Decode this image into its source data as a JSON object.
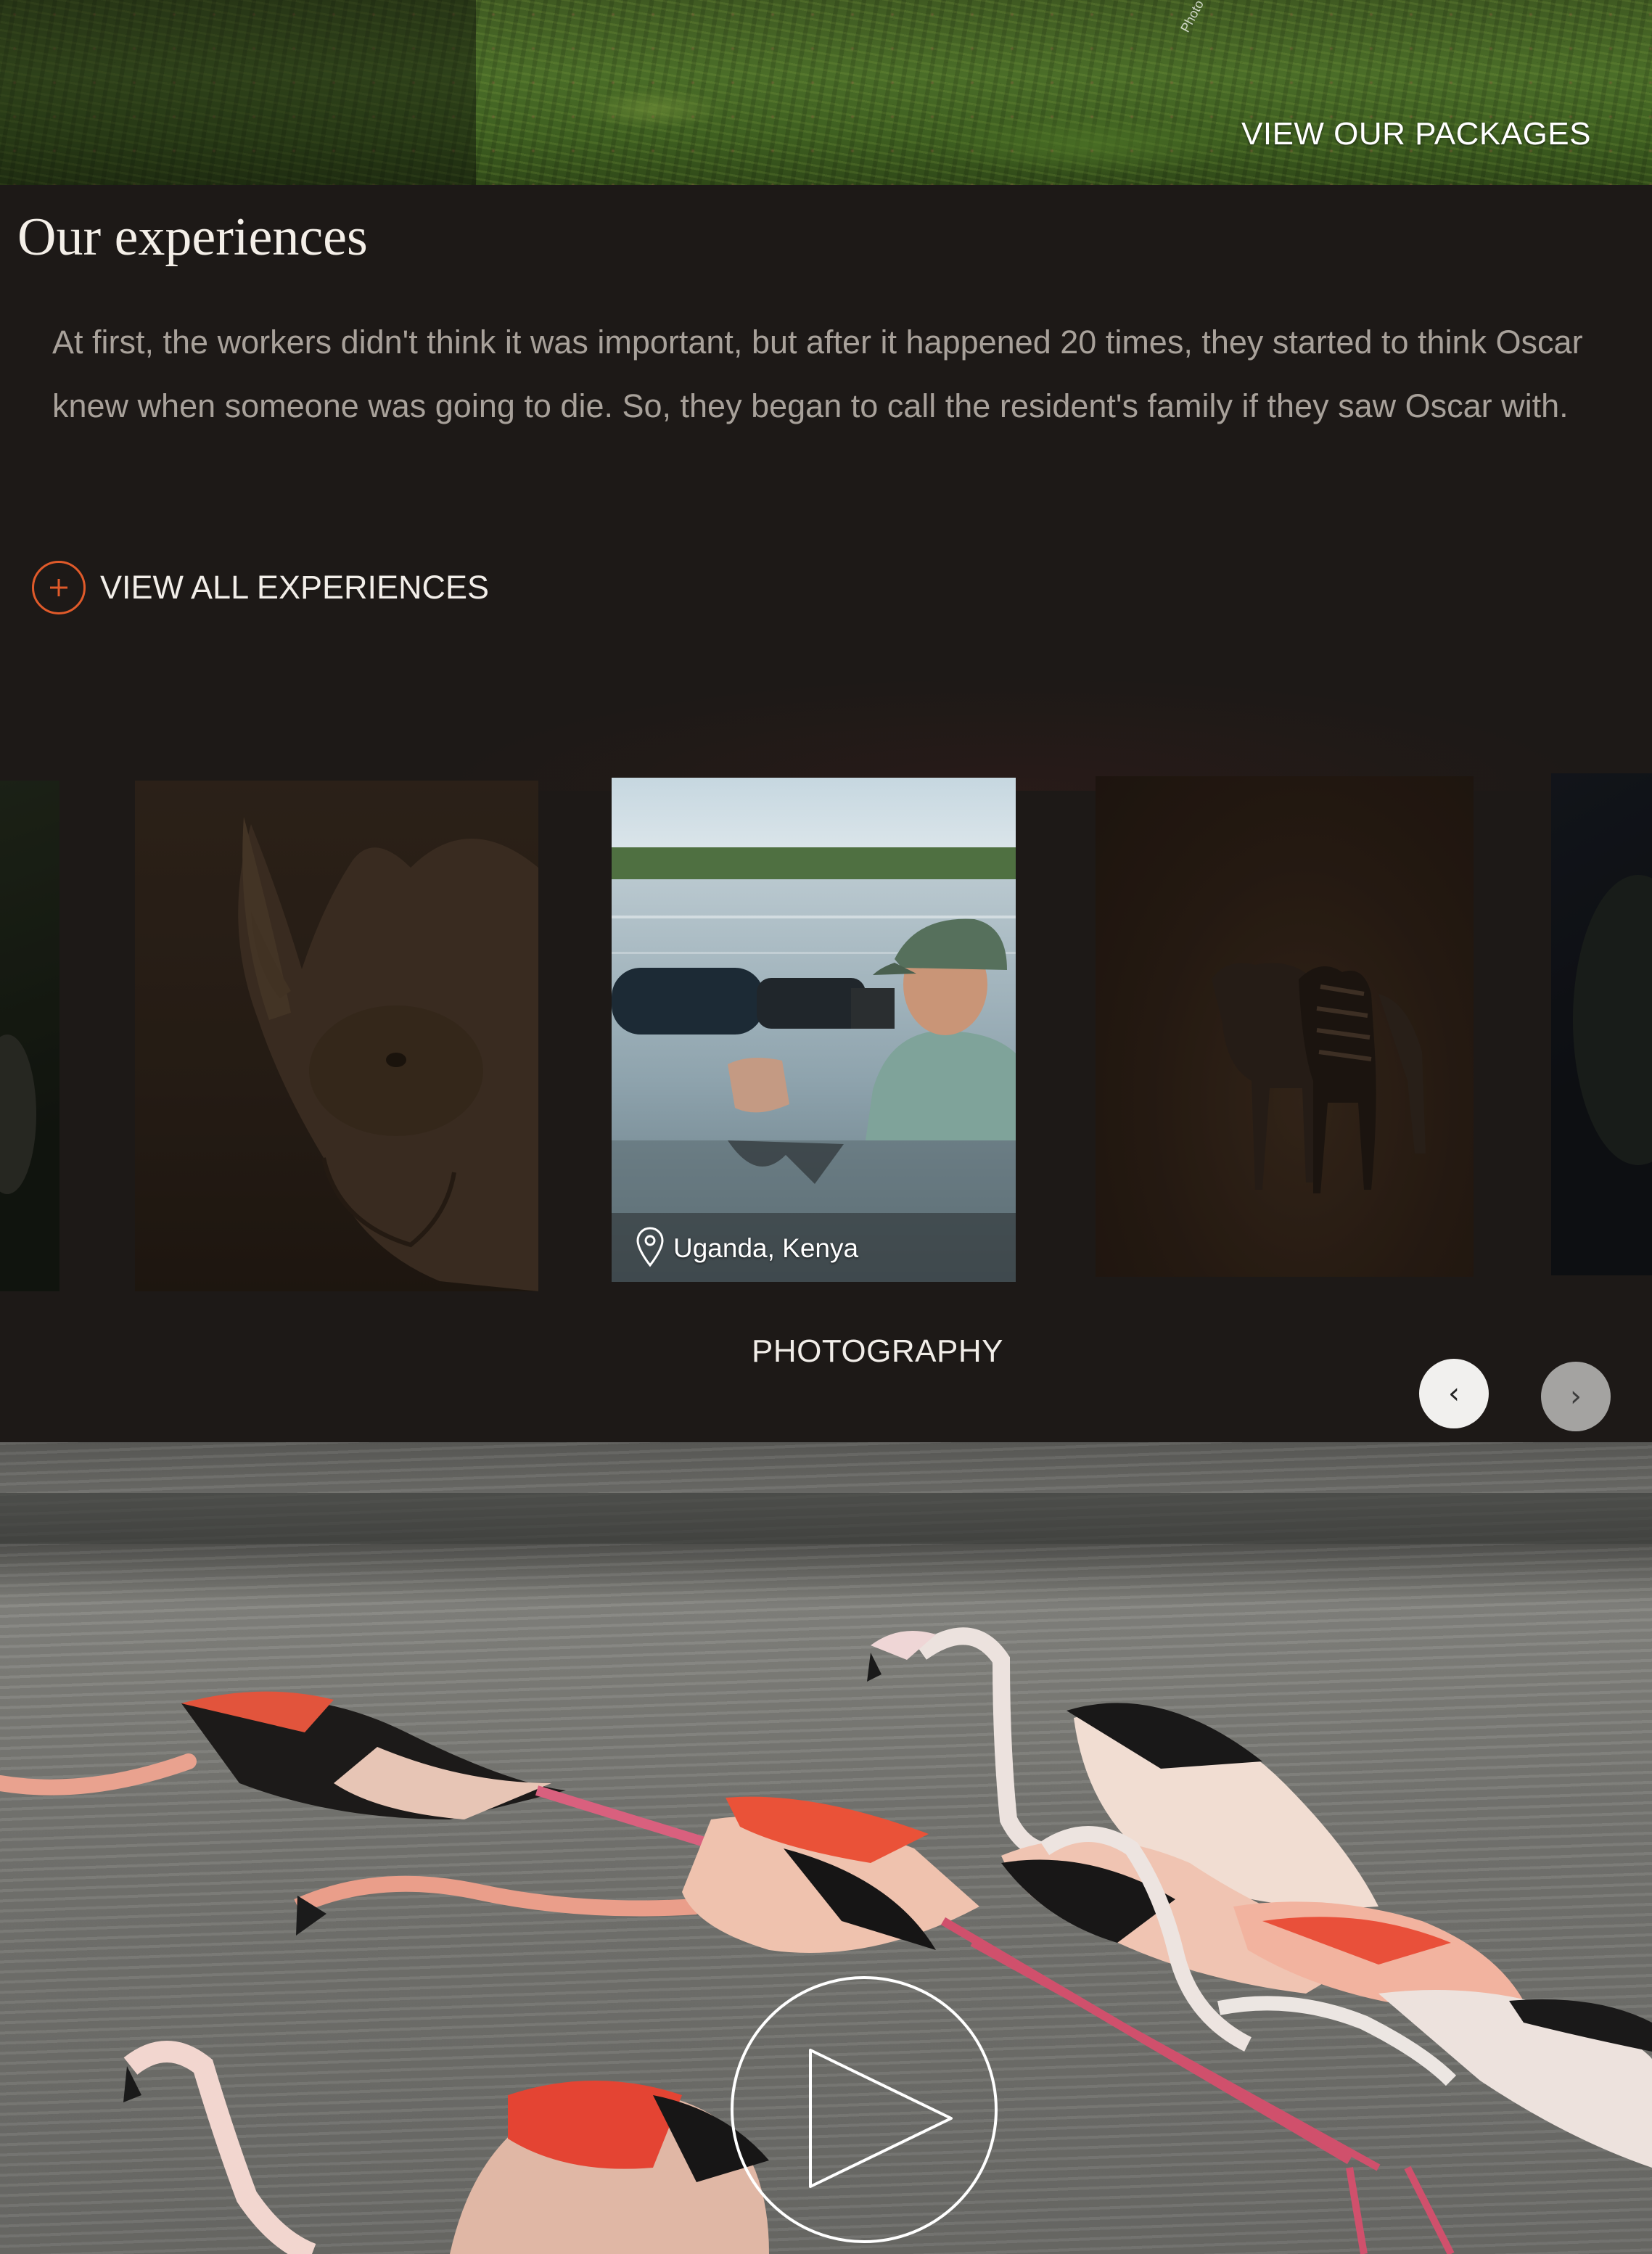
{
  "hero": {
    "cta_label": "VIEW OUR PACKAGES",
    "photo_credit": "Photo"
  },
  "experiences": {
    "title": "Our experiences",
    "body": "At first, the workers didn't think it was important, but after it happened 20 times, they started to think Oscar knew when someone was going to die. So, they began to call the resident's family if they saw Oscar with.",
    "view_all_label": "VIEW ALL EXPERIENCES"
  },
  "carousel": {
    "active_location": "Uganda, Kenya",
    "active_caption": "PHOTOGRAPHY",
    "prev_icon": "chevron-left-icon",
    "next_icon": "chevron-right-icon",
    "prev_glyph": "‹",
    "next_glyph": "›"
  },
  "video": {
    "play_icon": "play-icon"
  },
  "colors": {
    "background": "#1d1917",
    "accent": "#e05a2a",
    "text_light": "#f2eee9",
    "text_muted": "#a8a19a"
  }
}
